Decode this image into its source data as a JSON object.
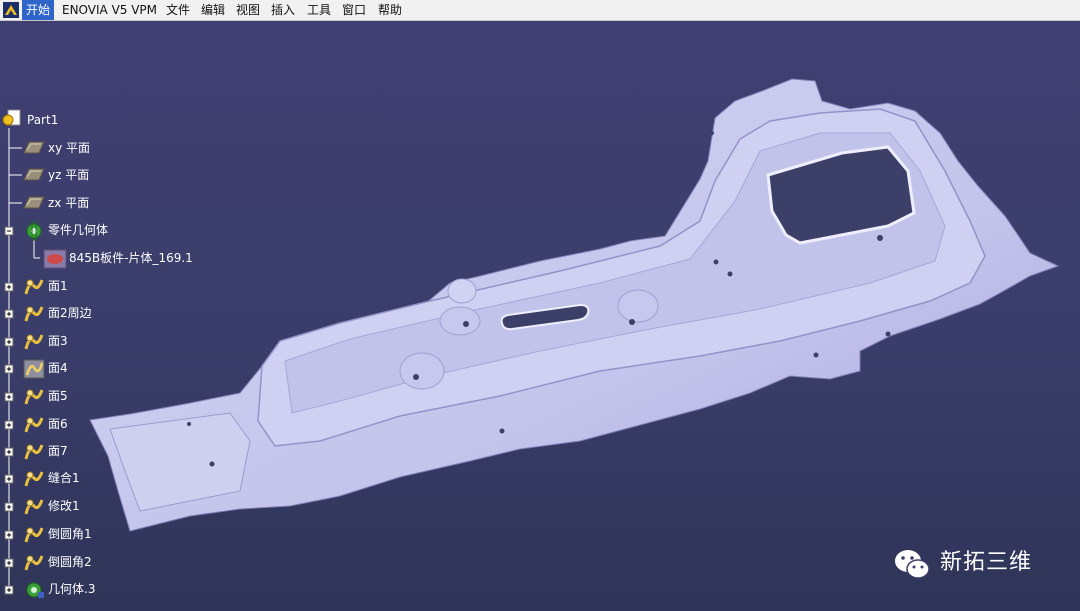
{
  "menubar": {
    "items": [
      "开始",
      "ENOVIA V5 VPM",
      "文件",
      "编辑",
      "视图",
      "插入",
      "工具",
      "窗口",
      "帮助"
    ],
    "active_index": 0,
    "active_color": "#2f64c8"
  },
  "tree": {
    "root": "Part1",
    "planes": [
      "xy 平面",
      "yz 平面",
      "zx 平面"
    ],
    "body": "零件几何体",
    "body_child": "845B板件-片体_169.1",
    "features": [
      "面1",
      "面2周边",
      "面3",
      "面4",
      "面5",
      "面6",
      "面7",
      "缝合1",
      "修改1",
      "倒圆角1",
      "倒圆角2",
      "几何体.3"
    ]
  },
  "colors": {
    "background": "#3c3f68",
    "part": "#c9c9ee",
    "part_shadow": "#8f90c4",
    "tree_text": "#ffffff"
  },
  "icons": {
    "logo": "catia-logo-icon",
    "plane": "plane-icon",
    "body": "gear-body-icon",
    "surface": "surface-icon",
    "feature": "feature-icon"
  },
  "watermark": {
    "text": "新拓三维",
    "icon": "wechat-icon"
  }
}
